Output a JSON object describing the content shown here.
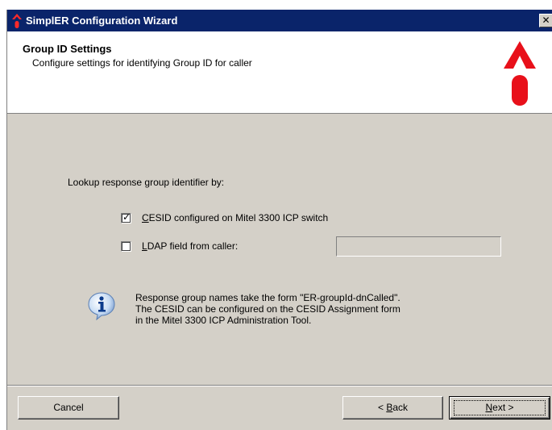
{
  "window": {
    "title": "SimplER Configuration Wizard",
    "close_glyph": "✕"
  },
  "header": {
    "title": "Group ID Settings",
    "subtitle": "Configure settings for identifying Group ID for caller"
  },
  "main": {
    "lookup_label": "Lookup response group identifier by:",
    "options": [
      {
        "mnemonic": "C",
        "label_rest": "ESID configured on Mitel 3300 ICP switch",
        "checked": true
      },
      {
        "mnemonic": "L",
        "label_rest": "DAP field from caller:",
        "checked": false
      }
    ],
    "ldap_field_value": "",
    "info_lines": [
      "Response group names take the form \"ER-groupId-dnCalled\".",
      "The CESID can be configured on the CESID Assignment form",
      "in the Mitel 3300 ICP Administration Tool."
    ]
  },
  "footer": {
    "cancel_label": "Cancel",
    "back_prefix": "< ",
    "back_mnemonic": "B",
    "back_rest": "ack",
    "next_mnemonic": "N",
    "next_rest": "ext >"
  },
  "colors": {
    "titlebar": "#0a246a",
    "dialog_face": "#d4d0c8",
    "logo_red": "#e8101a"
  },
  "icons": {
    "title": "simpler-logo-icon",
    "logo": "simpler-logo",
    "info": "info-icon"
  }
}
